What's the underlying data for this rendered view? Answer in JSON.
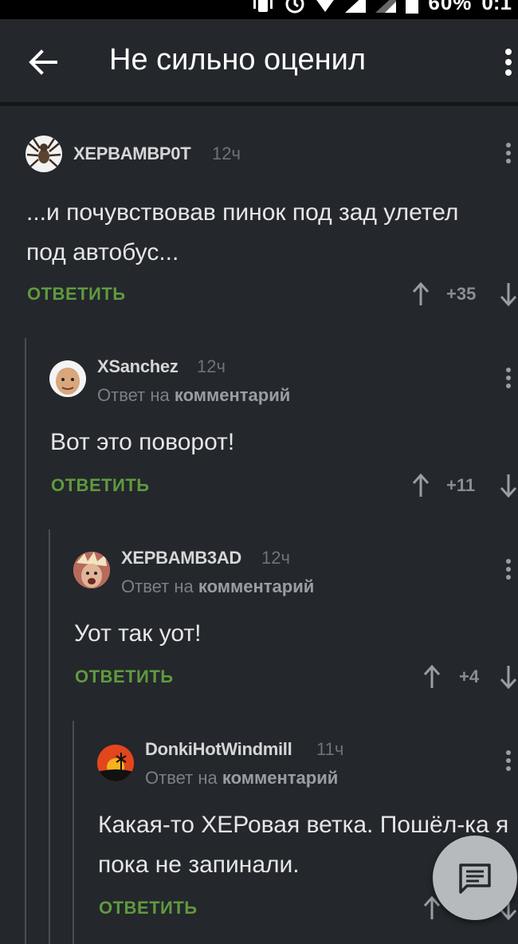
{
  "status_bar": {
    "battery": "60%",
    "time": "0:1"
  },
  "app_bar": {
    "title": "Не сильно оценил"
  },
  "comments": [
    {
      "username": "XEPBAMBP0T",
      "time": "12ч",
      "reply_to": null,
      "text": "...и почувствовав пинок под зад улетел под автобус...",
      "reply_label": "ОТВЕТИТЬ",
      "score": "+35"
    },
    {
      "username": "XSanchez",
      "time": "12ч",
      "reply_to": {
        "prefix": "Ответ на",
        "target": "комментарий"
      },
      "text": "Вот это поворот!",
      "reply_label": "ОТВЕТИТЬ",
      "score": "+11"
    },
    {
      "username": "XEPBAMB3AD",
      "time": "12ч",
      "reply_to": {
        "prefix": "Ответ на",
        "target": "комментарий"
      },
      "text": "Уот так уот!",
      "reply_label": "ОТВЕТИТЬ",
      "score": "+4"
    },
    {
      "username": "DonkiHotWindmill",
      "time": "11ч",
      "reply_to": {
        "prefix": "Ответ на",
        "target": "комментарий"
      },
      "text": "Какая-то ХЕРовая ветка. Пошёл-ка я пока не запинали.",
      "reply_label": "ОТВЕТИТЬ",
      "score": ""
    }
  ],
  "colors": {
    "background": "#24272c",
    "accent_green": "#5f9a3e",
    "fab": "#b7babd"
  }
}
